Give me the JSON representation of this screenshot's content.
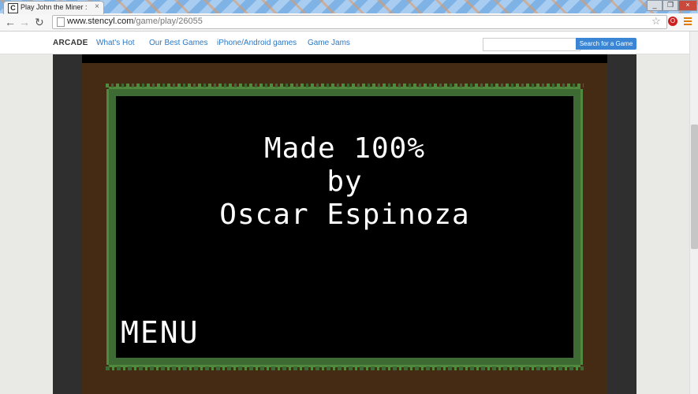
{
  "browser": {
    "tab_title": "Play John the Miner : Lud...",
    "tab_close": "×",
    "favicon": "C",
    "url_host": "www.stencyl.com",
    "url_path": "/game/play/26055",
    "back_icon": "arrow-left-icon",
    "forward_icon": "arrow-right-icon",
    "reload_icon": "reload-icon",
    "star_icon": "star-icon",
    "ext_label": "O",
    "window_controls": [
      "_",
      "❐",
      "×"
    ]
  },
  "site_nav": {
    "logo": "ARCADE",
    "links": [
      "What's Hot",
      "Our Best Games",
      "iPhone/Android games",
      "Game Jams"
    ],
    "search_placeholder": "",
    "search_button": "Search for a Game"
  },
  "game": {
    "credits_line1": "Made 100%",
    "credits_line2": "by",
    "credits_line3": "Oscar Espinoza",
    "menu_label": "MENU"
  },
  "colors": {
    "link": "#2a78c4",
    "search_button": "#3b86d4",
    "game_bg": "#452b14",
    "grass": "#4f8a3f"
  }
}
